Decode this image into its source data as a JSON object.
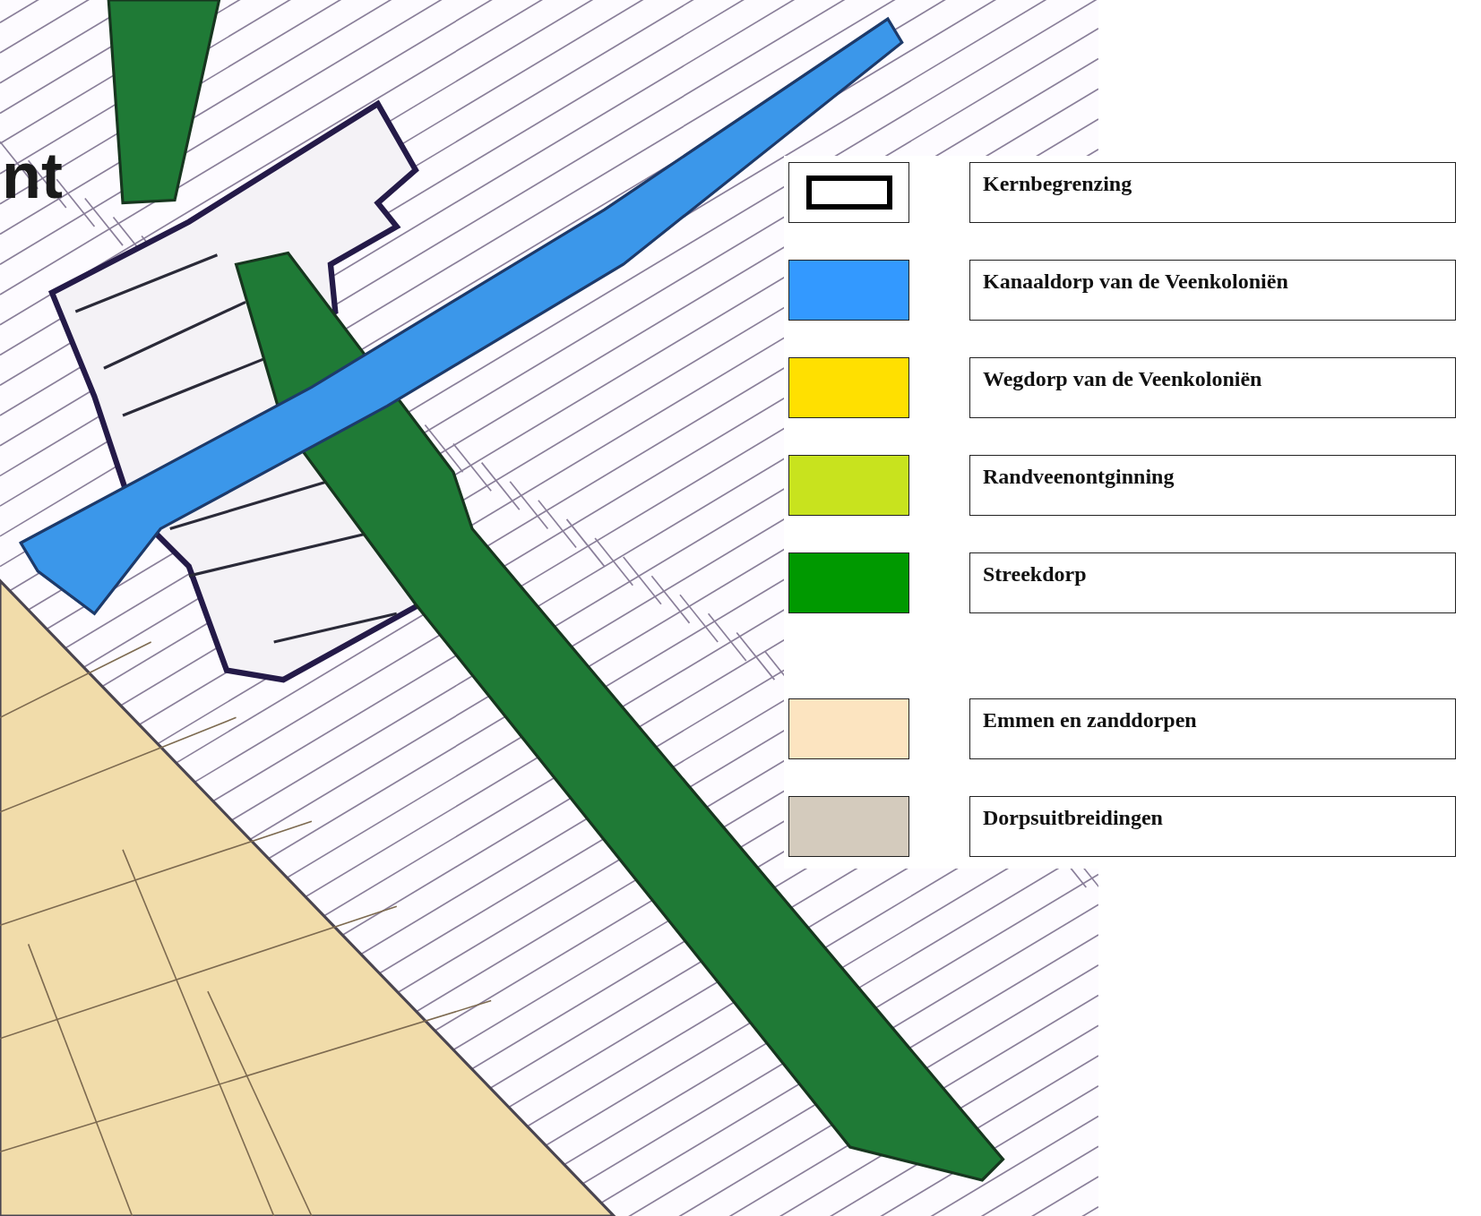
{
  "map": {
    "label": "nt"
  },
  "legend": {
    "groups": [
      {
        "items": [
          {
            "kind": "outline",
            "color": "#000000",
            "label": "Kernbegrenzing"
          },
          {
            "kind": "fill",
            "color": "#3399ff",
            "label": "Kanaaldorp van de Veenkoloniën"
          },
          {
            "kind": "fill",
            "color": "#ffe000",
            "label": "Wegdorp van de Veenkoloniën"
          },
          {
            "kind": "fill",
            "color": "#c8e31e",
            "label": "Randveenontginning"
          },
          {
            "kind": "fill",
            "color": "#009900",
            "label": "Streekdorp"
          }
        ]
      },
      {
        "items": [
          {
            "kind": "fill",
            "color": "#fce4c0",
            "label": "Emmen en zanddorpen"
          },
          {
            "kind": "fill",
            "color": "#d4cbbd",
            "label": "Dorpsuitbreidingen"
          }
        ]
      }
    ]
  }
}
